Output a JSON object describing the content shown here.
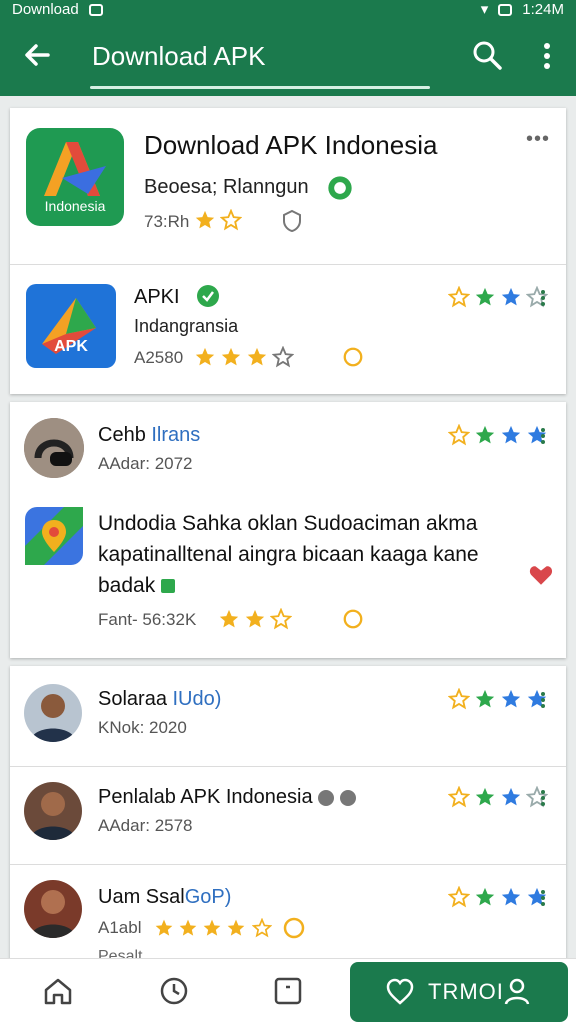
{
  "status_bar": {
    "left_text": "Download",
    "right_text": "1:24M"
  },
  "app_bar": {
    "title": "Download APK"
  },
  "header_card": {
    "logo_text": "Indonesia",
    "title": "Download APK Indonesia",
    "subtitle": "Beoesa; Rlanngun",
    "meta": "73:Rh",
    "more": "•••"
  },
  "apk_item": {
    "name": "APKI",
    "subtitle": "Indangransia",
    "meta": "A2580",
    "logo_text": "APK",
    "rating": {
      "filled": 2,
      "total": 4
    }
  },
  "review_card": {
    "reviewer_name": "Cehb",
    "reviewer_tag": "Ilrans",
    "reviewer_meta": "AAdar: 2072",
    "rating": {
      "filled": 4,
      "total": 4
    },
    "body_line1": "Undodia Sahka oklan Sudoaciman akma",
    "body_line2": "kapatinalltenal aingra bicaan kaaga kane",
    "body_line3": "badak",
    "footer_meta": "Fant- 56:32K"
  },
  "reviewers": [
    {
      "name": "Solaraa",
      "tag": "IUdo)",
      "meta": "KNok: 2020",
      "rating": {
        "filled": 3,
        "total": 4
      }
    },
    {
      "name": "Penlalab APK Indonesia",
      "tag": "",
      "meta": "AAdar: 2578",
      "rating": {
        "filled": 2,
        "total": 4
      }
    },
    {
      "name": "Uam Ssal",
      "tag": "GoP)",
      "meta": "A1abl",
      "rating": {
        "filled": 3,
        "total": 4
      },
      "cut_text": "Pesalt"
    }
  ],
  "bottom_nav": {
    "cta_label": "TRMOI"
  },
  "colors": {
    "primary": "#1b7a4d",
    "star_gold": "#f2b01e",
    "star_green": "#2ea84c",
    "star_blue": "#2f7be0"
  }
}
